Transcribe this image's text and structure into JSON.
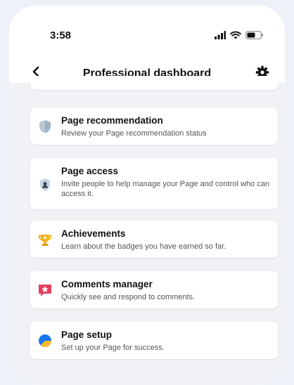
{
  "status_bar": {
    "time": "3:58",
    "icons": [
      "signal-icon",
      "wifi-icon",
      "battery-icon"
    ]
  },
  "nav": {
    "title": "Professional dashboard",
    "back_icon": "chevron-left-icon",
    "settings_icon": "gear-icon"
  },
  "items": [
    {
      "title": "Page recommendation",
      "description": "Review your Page recommendation status",
      "icon": "shield-icon"
    },
    {
      "title": "Page access",
      "description": "Invite people to help manage your Page and control who can access it.",
      "icon": "person-badge-icon"
    },
    {
      "title": "Achievements",
      "description": "Learn about the badges you have earned so far.",
      "icon": "trophy-icon"
    },
    {
      "title": "Comments manager",
      "description": "Quickly see and respond to comments.",
      "icon": "star-message-icon"
    },
    {
      "title": "Page setup",
      "description": "Set up your Page for success.",
      "icon": "pie-chart-icon"
    }
  ]
}
